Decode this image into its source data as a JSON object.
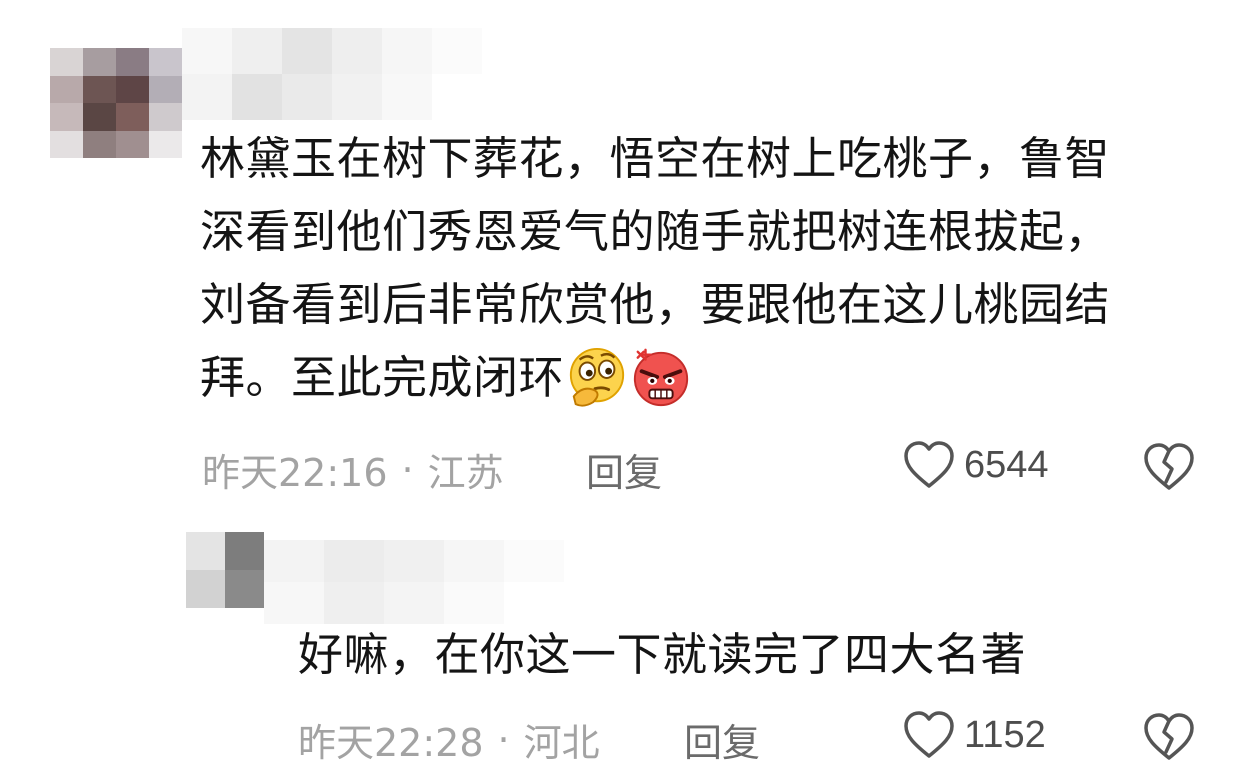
{
  "comments": [
    {
      "text_lines": [
        "林黛玉在树下葬花，悟空在树上吃桃子，鲁智",
        "深看到他们秀恩爱气的随手就把树连根拔起，",
        "刘备看到后非常欣赏他，要跟他在这儿桃园结",
        "拜。至此完成闭环"
      ],
      "emojis": [
        "thinking-face-emoji",
        "angry-face-emoji"
      ],
      "time": "昨天22:16",
      "separator": "·",
      "location": "江苏",
      "reply_label": "回复",
      "likes": "6544"
    },
    {
      "text_lines": [
        "好嘛，在你这一下就读完了四大名著"
      ],
      "time": "昨天22:28",
      "separator": "·",
      "location": "河北",
      "reply_label": "回复",
      "likes": "1152"
    }
  ],
  "icons": {
    "like": "heart-outline-icon",
    "dislike": "broken-heart-icon"
  },
  "colors": {
    "text": "#141414",
    "meta": "#a3a3a3",
    "reply": "#6b6b6b",
    "icon": "#4d4d4d"
  }
}
